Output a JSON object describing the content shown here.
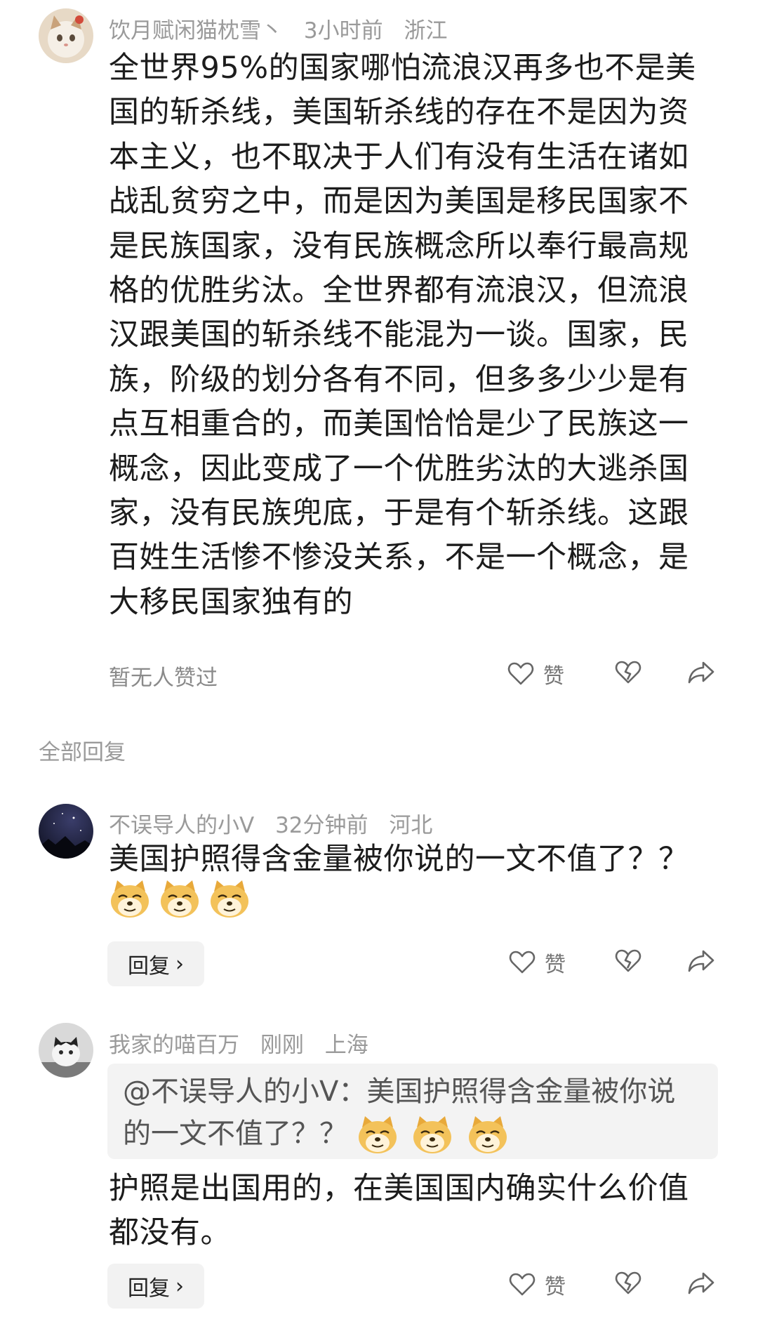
{
  "comment1": {
    "username": "饮月赋闲猫枕雪丶",
    "time": "3小时前",
    "location": "浙江",
    "text": "全世界95%的国家哪怕流浪汉再多也不是美国的斩杀线，美国斩杀线的存在不是因为资本主义，也不取决于人们有没有生活在诸如战乱贫穷之中，而是因为美国是移民国家不是民族国家，没有民族概念所以奉行最高规格的优胜劣汰。全世界都有流浪汉，但流浪汉跟美国的斩杀线不能混为一谈。国家，民族，阶级的划分各有不同，但多多少少是有点互相重合的，而美国恰恰是少了民族这一概念，因此变成了一个优胜劣汰的大逃杀国家，没有民族兜底，于是有个斩杀线。这跟百姓生活惨不惨没关系，不是一个概念，是大移民国家独有的",
    "likes_status": "暂无人赞过",
    "like_label": "赞"
  },
  "section_title": "全部回复",
  "reply1": {
    "username": "不误导人的小V",
    "time": "32分钟前",
    "location": "河北",
    "text": "美国护照得含金量被你说的一文不值了？？",
    "emojis": [
      "doge-emoji",
      "doge-emoji",
      "doge-emoji"
    ],
    "reply_label": "回复",
    "like_label": "赞"
  },
  "reply2": {
    "username": "我家的喵百万",
    "time": "刚刚",
    "location": "上海",
    "quote_text": "@不误导人的小V：美国护照得含金量被你说的一文不值了？？",
    "quote_emojis": [
      "doge-emoji",
      "doge-emoji",
      "doge-emoji"
    ],
    "text": "护照是出国用的，在美国国内确实什么价值都没有。",
    "reply_label": "回复",
    "like_label": "赞"
  },
  "icons": {
    "like": "heart-outline-icon",
    "dislike": "broken-heart-icon",
    "share": "share-arrow-icon",
    "reply_chevron": "chevron-right-icon"
  },
  "colors": {
    "meta_gray": "#9a9a9a",
    "body_text": "#1c1c1c",
    "reply_bg": "#f2f2f2",
    "quote_bg": "#f3f3f3"
  }
}
